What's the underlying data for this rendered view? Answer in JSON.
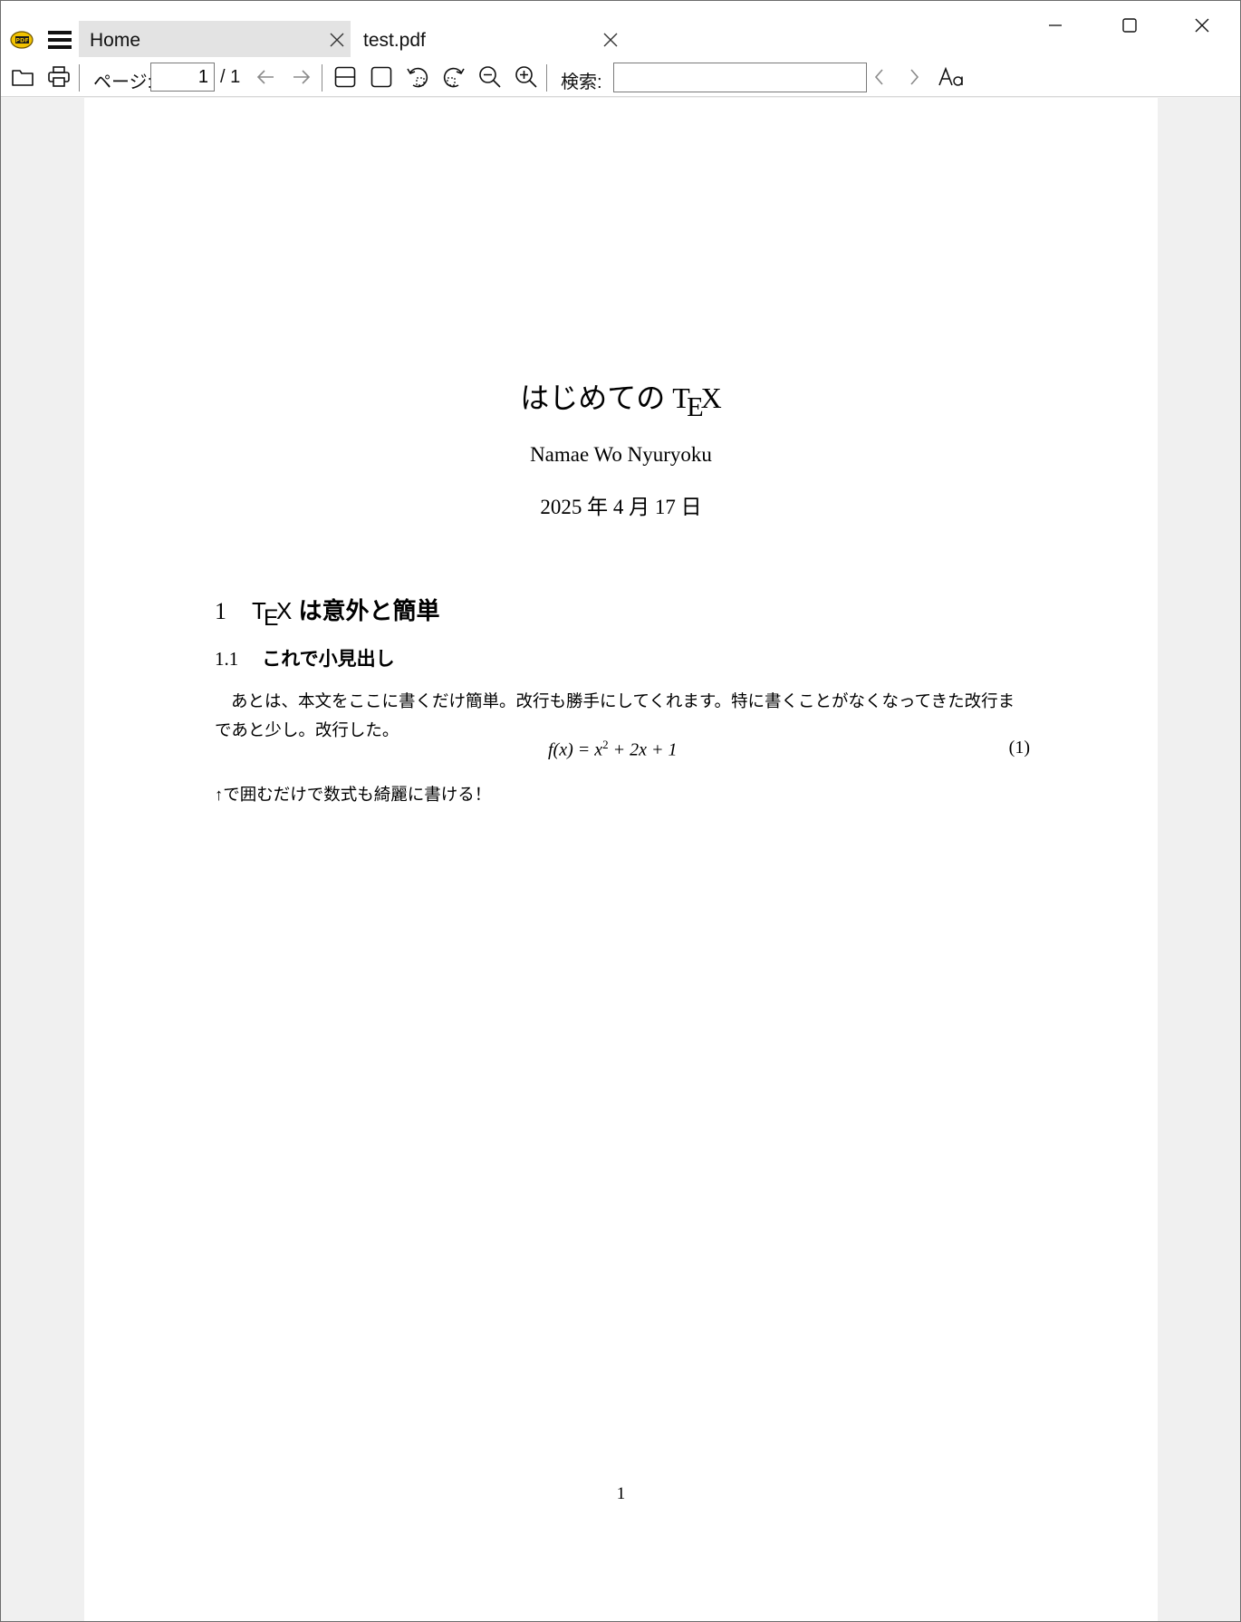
{
  "tabs": [
    {
      "label": "Home"
    },
    {
      "label": "test.pdf"
    }
  ],
  "toolbar": {
    "page_label": "ページ:",
    "page_value": "1",
    "page_total": "/ 1",
    "search_label": "検索:",
    "search_value": ""
  },
  "document": {
    "title_text": "はじめての",
    "tex_t": "T",
    "tex_e": "E",
    "tex_x": "X",
    "author": "Namae Wo Nyuryoku",
    "date": "2025 年 4 月 17 日",
    "section": {
      "number": "1",
      "title_suffix": " は意外と簡単"
    },
    "subsection": {
      "number": "1.1",
      "title": "これで小見出し"
    },
    "paragraph": "あとは、本文をここに書くだけ簡単。改行も勝手にしてくれます。特に書くことがなくなってきた改行まであと少し。改行した。",
    "equation": {
      "lhs": "f(x) = x",
      "exponent": "2",
      "rhs": " + 2x + 1",
      "number": "(1)"
    },
    "after_equation": "↑で囲むだけで数式も綺麗に書ける！",
    "page_number": "1"
  },
  "icons": [
    "app-pdf-icon",
    "hamburger-menu-icon",
    "close-tab-icon",
    "minimize-icon",
    "maximize-icon",
    "close-window-icon",
    "folder-open-icon",
    "print-icon",
    "arrow-left-icon",
    "arrow-right-icon",
    "fit-width-icon",
    "fit-page-icon",
    "rotate-left-icon",
    "rotate-right-icon",
    "zoom-out-icon",
    "zoom-in-icon",
    "chevron-left-icon",
    "chevron-right-icon",
    "match-case-icon"
  ]
}
